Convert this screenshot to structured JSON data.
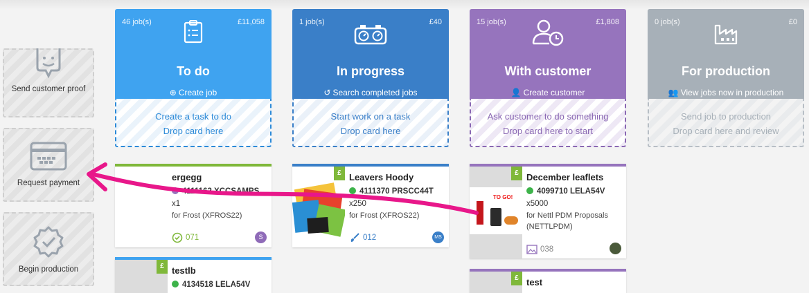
{
  "actions": [
    {
      "label": "Send customer proof",
      "icon": "chat-smile-icon"
    },
    {
      "label": "Request payment",
      "icon": "credit-card-icon"
    },
    {
      "label": "Begin production",
      "icon": "verified-badge-icon"
    }
  ],
  "columns": [
    {
      "count": "46 job(s)",
      "value": "£11,058",
      "title": "To do",
      "link": "Create job",
      "link_icon": "plus-circle-icon",
      "drop_line1": "Create a task to do",
      "drop_line2": "Drop card here",
      "color": "#3fa3f0",
      "drop_color": "#2c8ad8"
    },
    {
      "count": "1 job(s)",
      "value": "£40",
      "title": "In progress",
      "link": "Search completed jobs",
      "link_icon": "history-icon",
      "drop_line1": "Start work on a task",
      "drop_line2": "Drop card here",
      "color": "#3a7fc8",
      "drop_color": "#3a7fc8"
    },
    {
      "count": "15 job(s)",
      "value": "£1,808",
      "title": "With customer",
      "link": "Create customer",
      "link_icon": "user-plus-icon",
      "drop_line1": "Ask customer to do something",
      "drop_line2": "Drop card here to start",
      "color": "#9674bd",
      "drop_color": "#8a68b3"
    },
    {
      "count": "0 job(s)",
      "value": "£0",
      "title": "For production",
      "link": "View jobs now in production",
      "link_icon": "users-icon",
      "drop_line1": "Send job to production",
      "drop_line2": "Drop card here and review",
      "color": "#a7b0b8",
      "drop_color": "#a7b0b8"
    }
  ],
  "cards": {
    "ergegg": {
      "name": "ergegg",
      "code": "4111162 XCCSAMPS",
      "qty": "x1",
      "customer": "for Frost (XFROS22)",
      "ref": "071",
      "avatar": "S"
    },
    "leavers": {
      "name": "Leavers Hoody",
      "code": "4111370 PRSCC44T",
      "qty": "x250",
      "customer": "for Frost (XFROS22)",
      "ref": "012",
      "avatar": "MS"
    },
    "december": {
      "name": "December leaflets",
      "code": "4099710 LELA54V",
      "qty": "x5000",
      "customer": "for Nettl PDM Proposals (NETTLPDM)",
      "ref": "038",
      "thumb_text": "TO GO!"
    },
    "testlb": {
      "name": "testlb",
      "code": "4134518 LELA54V"
    },
    "test": {
      "name": "test"
    }
  },
  "badge": "£",
  "colors": {
    "green": "#7fb83a",
    "arrow": "#e8178a"
  }
}
